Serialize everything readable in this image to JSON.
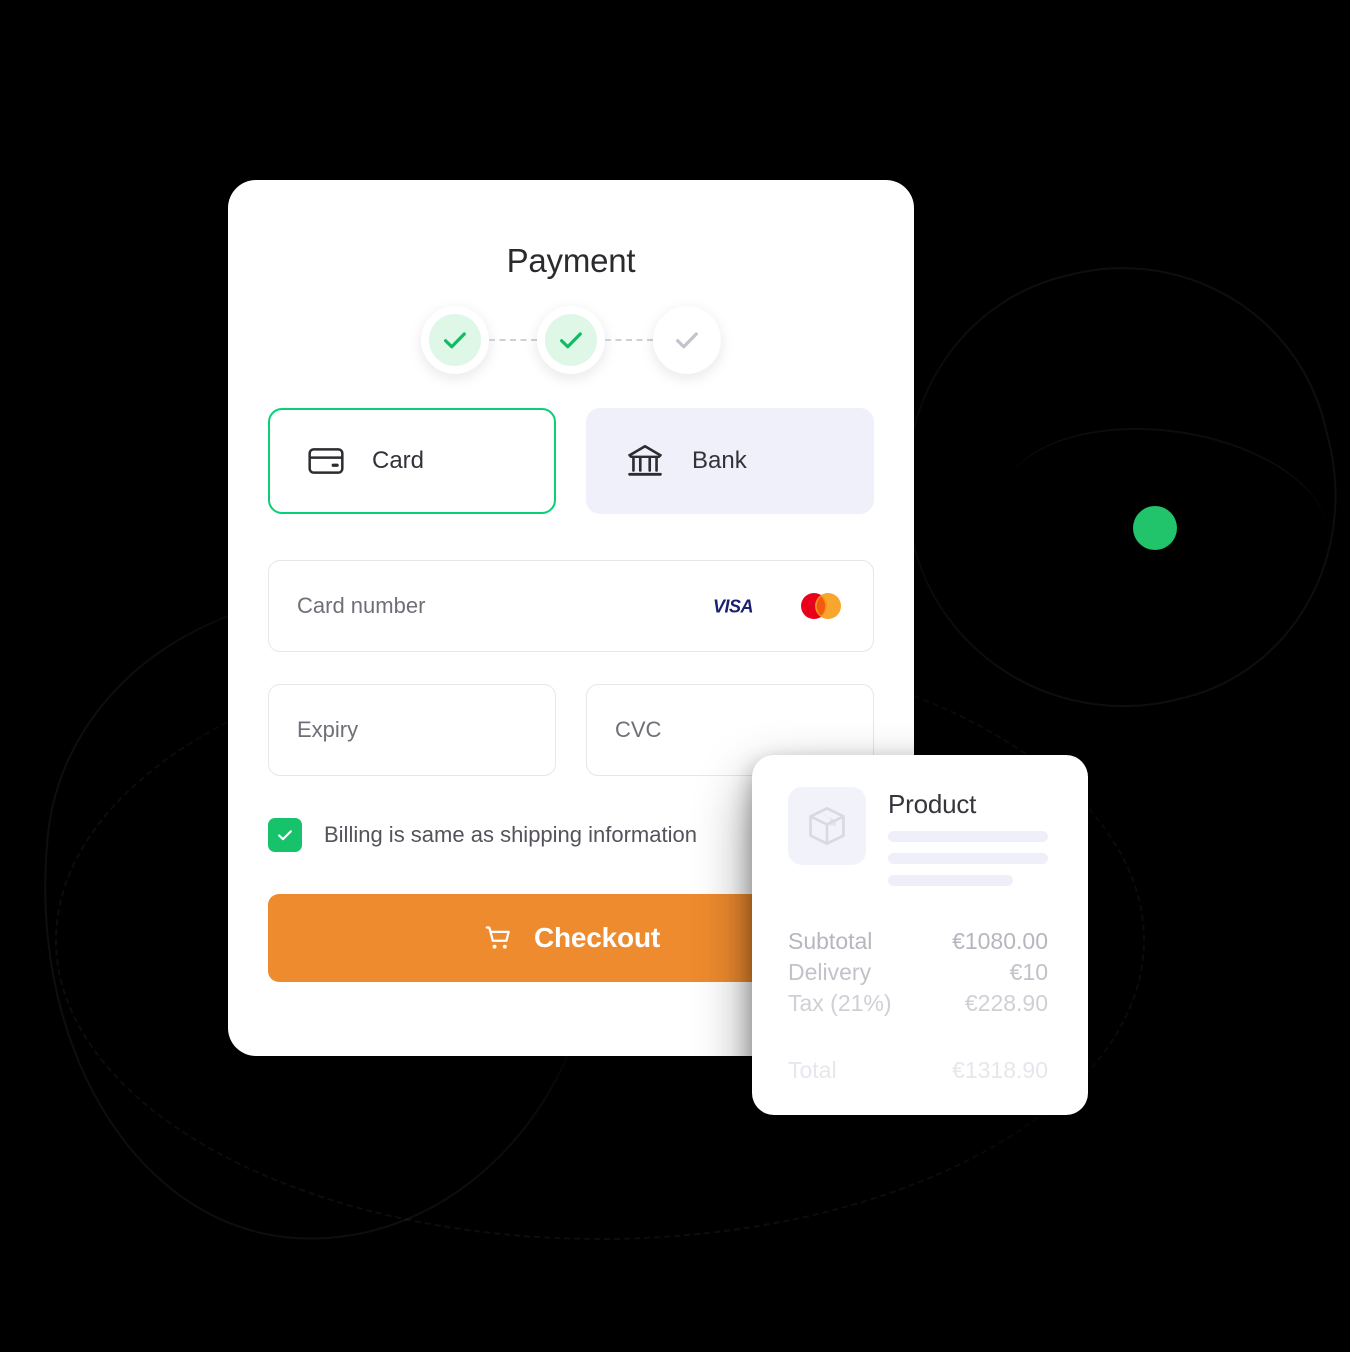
{
  "payment": {
    "title": "Payment",
    "stepper": {
      "steps": [
        {
          "state": "done",
          "icon": "check-icon"
        },
        {
          "state": "done",
          "icon": "check-icon"
        },
        {
          "state": "pending",
          "icon": "check-icon"
        }
      ]
    },
    "methods": [
      {
        "label": "Card",
        "icon": "credit-card-icon",
        "selected": true
      },
      {
        "label": "Bank",
        "icon": "bank-icon",
        "selected": false
      }
    ],
    "fields": {
      "card_number_placeholder": "Card number",
      "expiry_placeholder": "Expiry",
      "cvc_placeholder": "CVC"
    },
    "card_brands": [
      {
        "name": "visa-logo",
        "label": "VISA"
      },
      {
        "name": "mastercard-logo",
        "label": ""
      }
    ],
    "billing": {
      "label": "Billing is same as shipping information",
      "checked": true
    },
    "checkout": {
      "label": "Checkout",
      "icon": "shopping-cart-icon"
    }
  },
  "summary": {
    "product_title": "Product",
    "product_icon": "package-box-icon",
    "rows": [
      {
        "label": "Subtotal",
        "value": "€1080.00"
      },
      {
        "label": "Delivery",
        "value": "€10"
      },
      {
        "label": "Tax (21%)",
        "value": "€228.90"
      }
    ],
    "total": {
      "label": "Total",
      "value": "€1318.90"
    }
  },
  "colors": {
    "accent_green": "#0ACF76",
    "checkbox_green": "#16C26A",
    "checkout_orange": "#EE8B2E",
    "tab_unselected_bg": "#F0F0FA",
    "visa_blue": "#1A1F71",
    "mastercard_red": "#EB001B",
    "mastercard_orange": "#F79E1B",
    "decor_dot_green": "#21C46B"
  }
}
